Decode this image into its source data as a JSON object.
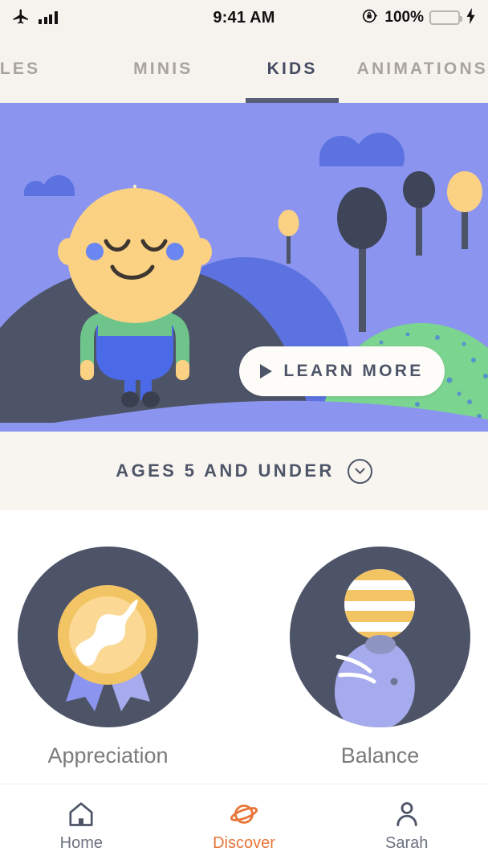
{
  "status_bar": {
    "airplane_icon": "airplane-icon",
    "signal_icon": "signal-bars-icon",
    "time": "9:41 AM",
    "rotation_lock_icon": "rotation-lock-icon",
    "battery_percent": "100%",
    "battery_icon": "battery-icon",
    "charging_icon": "lightning-bolt-icon",
    "battery_color": "#4cd964"
  },
  "tabs": {
    "items": [
      {
        "label": "NGLES",
        "active": false
      },
      {
        "label": "MINIS",
        "active": false
      },
      {
        "label": "KIDS",
        "active": true
      },
      {
        "label": "ANIMATIONS",
        "active": false
      }
    ],
    "active_underline_color": "#565e78",
    "active_text_color": "#444c63",
    "inactive_text_color": "#a8a49d"
  },
  "hero": {
    "sky_color": "#8b95ef",
    "hill_dark_color": "#4e5468",
    "hill_blue_color": "#5b72e0",
    "hill_green_color": "#7bd48f",
    "character": {
      "sprout_color": "#7bd48f",
      "head_color": "#fbd183",
      "cheek_color": "#5b72e0",
      "shirt_color": "#6fc48c",
      "pants_color": "#4a6ae8",
      "shoe_color": "#3a3f4f"
    },
    "learn_more": {
      "label": "LEARN MORE",
      "play_icon": "play-triangle-icon",
      "background": "#fdfcf9",
      "text_color": "#4e5568"
    }
  },
  "ages_filter": {
    "label": "AGES 5 AND UNDER",
    "chevron_icon": "chevron-down-circle-icon",
    "background": "#f8f5f0",
    "text_color": "#4e5568"
  },
  "cards": {
    "background": "#ffffff",
    "circle_color": "#4e5468",
    "items": [
      {
        "label": "Appreciation",
        "icon": "award-medal-icon",
        "medal_color": "#f3c463",
        "medal_inner_color": "#fbd995",
        "ribbon_color": "#8b95ef"
      },
      {
        "label": "Balance",
        "icon": "seal-balancing-ball-icon",
        "ball_stripe_color": "#f3c463",
        "seal_color": "#a6abed"
      }
    ]
  },
  "bottom_nav": {
    "active_color": "#e8763a",
    "inactive_color": "#6b7280",
    "items": [
      {
        "label": "Home",
        "icon": "home-icon",
        "active": false
      },
      {
        "label": "Discover",
        "icon": "planet-icon",
        "active": true
      },
      {
        "label": "Sarah",
        "icon": "person-icon",
        "active": false
      }
    ]
  }
}
